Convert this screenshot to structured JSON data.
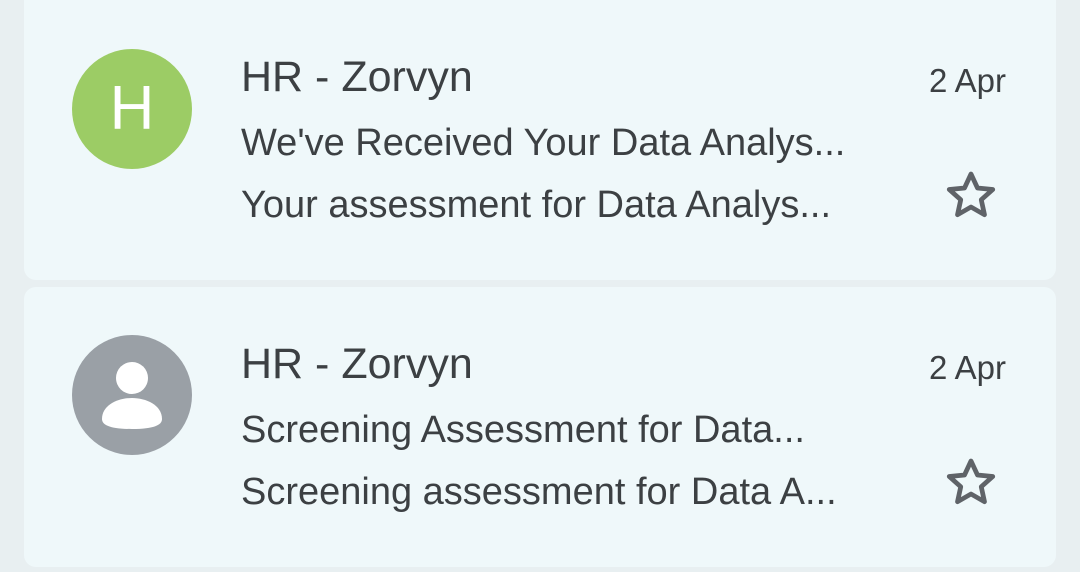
{
  "emails": [
    {
      "avatar_letter": "H",
      "avatar_color": "#9ccc65",
      "avatar_type": "letter",
      "sender": "HR - Zorvyn",
      "date": "2 Apr",
      "subject": "We've Received Your Data Analys...",
      "snippet": "Your assessment for Data Analys...",
      "star_icon": "star-outline-icon",
      "starred": false
    },
    {
      "avatar_type": "generic-person",
      "avatar_color": "#9aa0a6",
      "avatar_icon": "person-icon",
      "sender": "HR - Zorvyn",
      "date": "2 Apr",
      "subject": "Screening Assessment for Data...",
      "snippet": "Screening assessment for Data A...",
      "star_icon": "star-outline-icon",
      "starred": false
    }
  ]
}
